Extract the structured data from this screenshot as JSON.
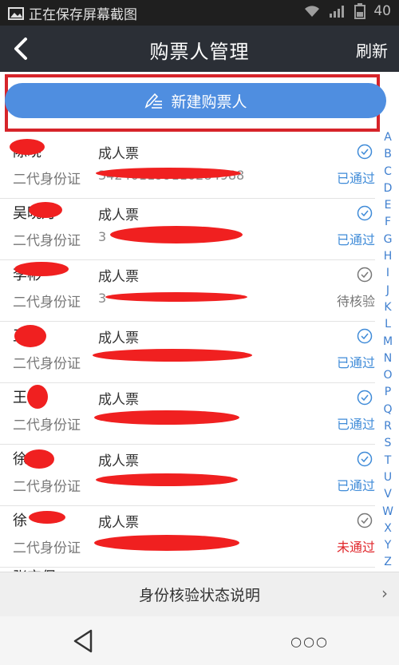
{
  "statusbar": {
    "notification": "正在保存屏幕截图",
    "battery": "40"
  },
  "header": {
    "title": "购票人管理",
    "refresh": "刷新"
  },
  "new_button": {
    "label": "新建购票人"
  },
  "passengers": [
    {
      "name": "陈晓",
      "ticket": "成人票",
      "id_type": "二代身份证",
      "id_no": "342401199110284988",
      "status": "已通过",
      "state": "ok"
    },
    {
      "name": "吴晓月",
      "ticket": "成人票",
      "id_type": "二代身份证",
      "id_no": "3",
      "status": "已通过",
      "state": "ok"
    },
    {
      "name": "李彬",
      "ticket": "成人票",
      "id_type": "二代身份证",
      "id_no": "3",
      "status": "待核验",
      "state": "pending"
    },
    {
      "name": "王",
      "ticket": "成人票",
      "id_type": "二代身份证",
      "id_no": "",
      "status": "已通过",
      "state": "ok"
    },
    {
      "name": "王",
      "ticket": "成人票",
      "id_type": "二代身份证",
      "id_no": "",
      "status": "已通过",
      "state": "ok"
    },
    {
      "name": "徐",
      "ticket": "成人票",
      "id_type": "二代身份证",
      "id_no": "",
      "status": "已通过",
      "state": "ok"
    },
    {
      "name": "徐",
      "ticket": "成人票",
      "id_type": "二代身份证",
      "id_no": "",
      "status": "未通过",
      "state": "fail"
    }
  ],
  "partial_row_name": "张宝保",
  "alphabet": [
    "A",
    "B",
    "C",
    "D",
    "E",
    "F",
    "G",
    "H",
    "I",
    "J",
    "K",
    "L",
    "M",
    "N",
    "O",
    "P",
    "Q",
    "R",
    "S",
    "T",
    "U",
    "V",
    "W",
    "X",
    "Y",
    "Z"
  ],
  "footer": {
    "label": "身份核验状态说明",
    "chevron": "›"
  },
  "colors": {
    "accent": "#4f8ee0",
    "header": "#2b2f36",
    "ok": "#3f8bd8",
    "fail": "#e0262b",
    "highlight": "#d6242a"
  }
}
